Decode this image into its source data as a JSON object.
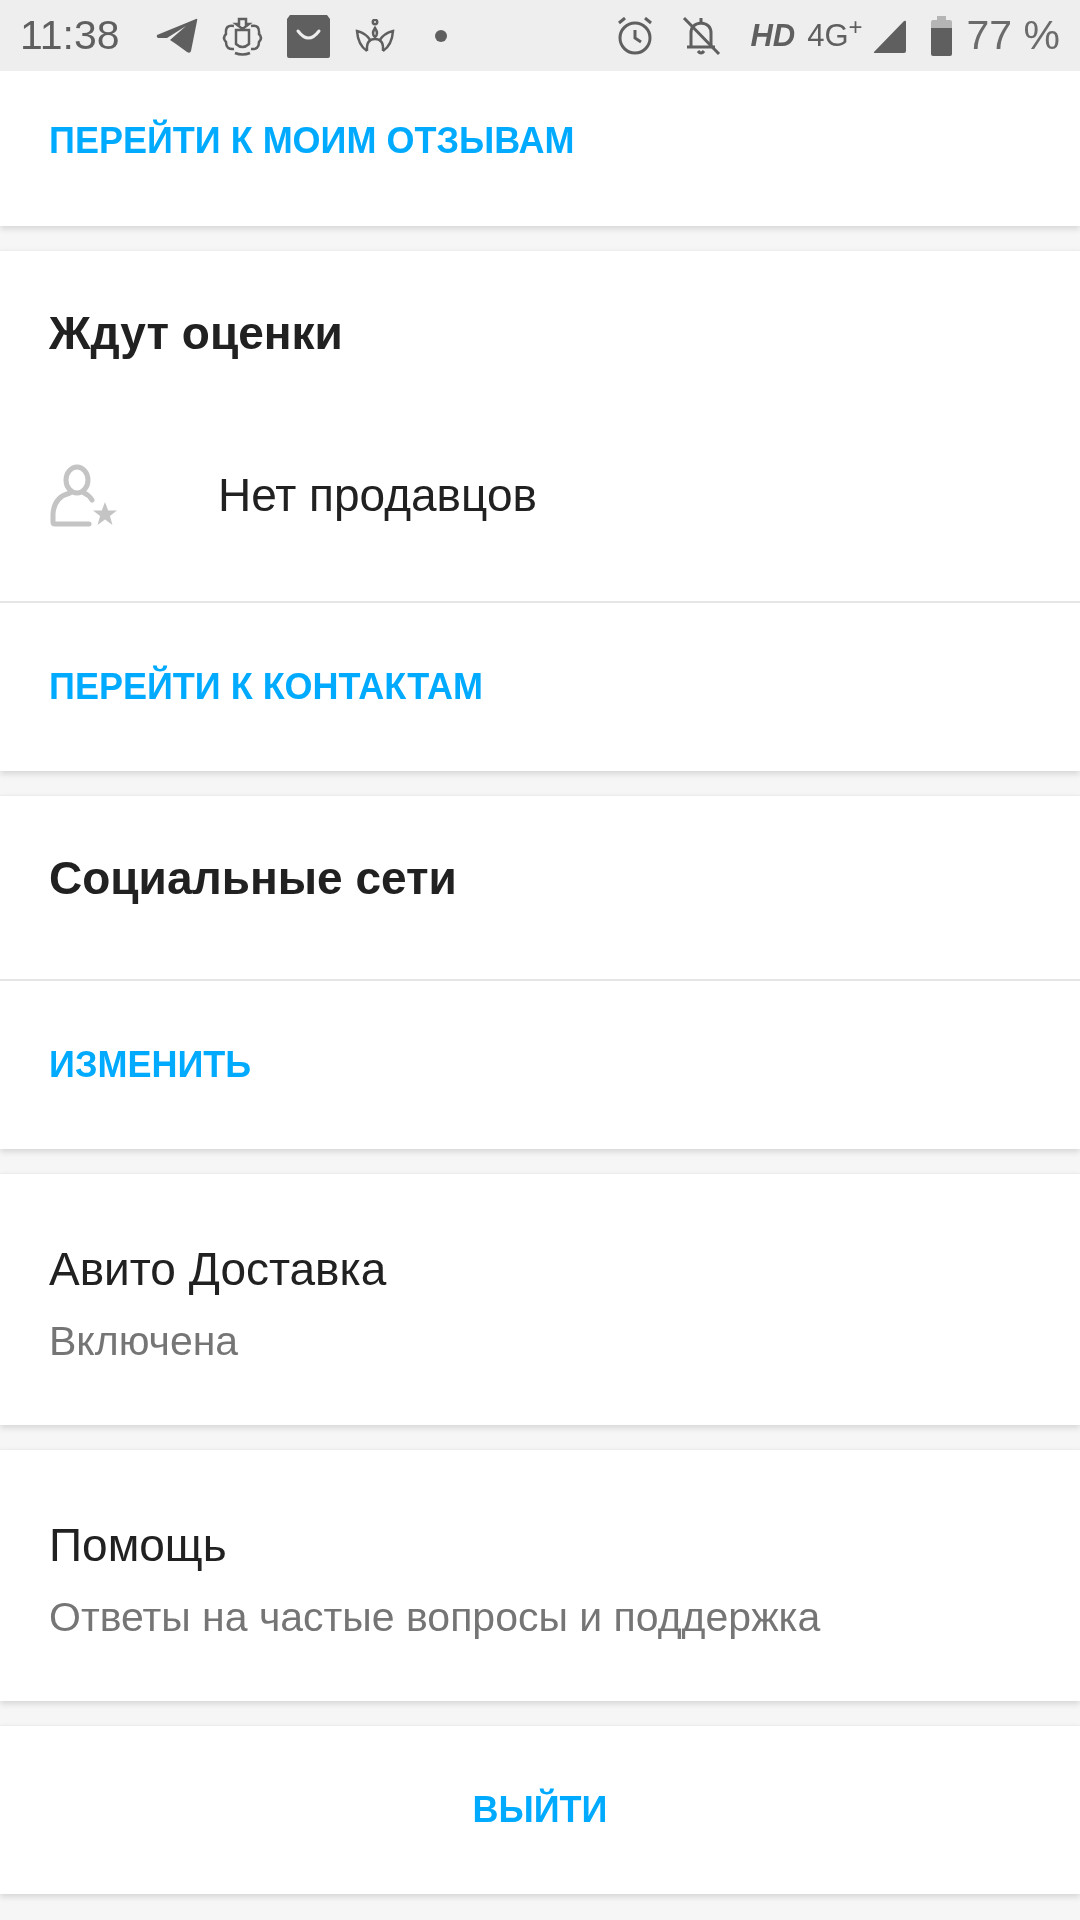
{
  "status_bar": {
    "time": "11:38",
    "hd": "HD",
    "network": "4G$^{+}$",
    "battery": "77 %"
  },
  "cards": [
    {
      "rows": [
        {
          "kind": "link",
          "label": "ПЕРЕЙТИ К МОИМ ОТЗЫВАМ"
        }
      ]
    },
    {
      "rows": [
        {
          "kind": "heading",
          "label": "Ждут оценки"
        },
        {
          "kind": "empty",
          "label": "Нет продавцов"
        },
        {
          "kind": "link",
          "label": "ПЕРЕЙТИ К КОНТАКТАМ"
        }
      ]
    },
    {
      "rows": [
        {
          "kind": "heading",
          "label": "Социальные сети"
        },
        {
          "kind": "link",
          "label": "ИЗМЕНИТЬ"
        }
      ]
    },
    {
      "rows": [
        {
          "kind": "item",
          "title": "Авито Доставка",
          "subtitle": "Включена"
        }
      ]
    },
    {
      "rows": [
        {
          "kind": "item",
          "title": "Помощь",
          "subtitle": "Ответы на частые вопросы и поддержка"
        }
      ]
    },
    {
      "rows": [
        {
          "kind": "button",
          "label": "ВЫЙТИ"
        }
      ]
    }
  ]
}
